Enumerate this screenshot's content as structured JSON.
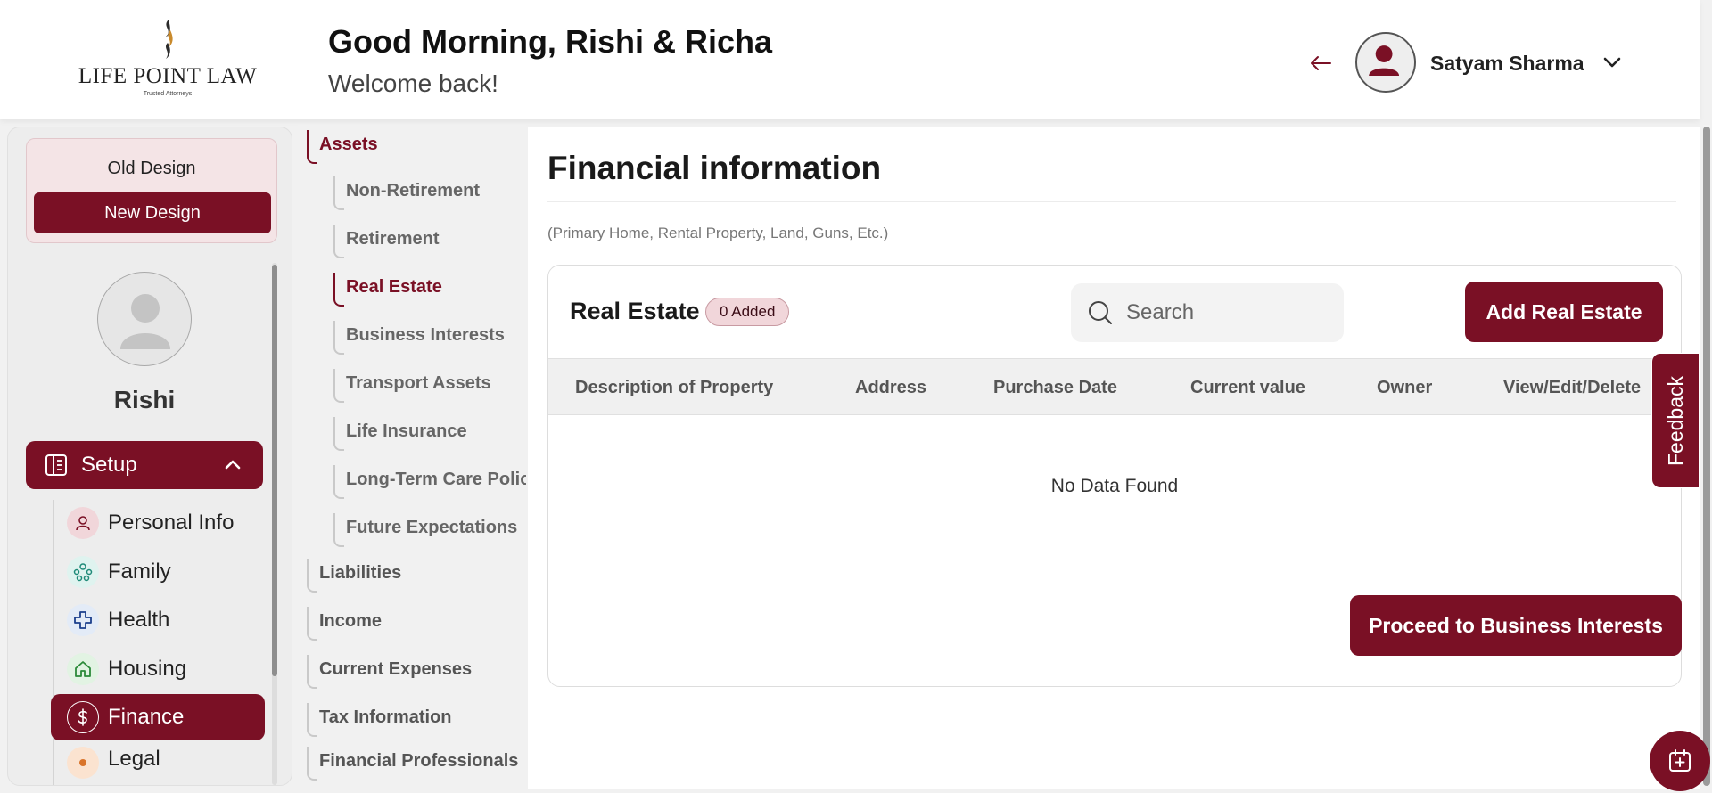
{
  "brand": {
    "name": "LIFE POINT LAW",
    "tagline": "Trusted Attorneys",
    "accent_color": "#7a1025"
  },
  "header": {
    "greeting": "Good Morning, Rishi & Richa",
    "subtitle": "Welcome back!",
    "back_icon": "arrow-left-icon",
    "user_name": "Satyam Sharma",
    "user_menu_icon": "chevron-down-icon"
  },
  "design_switch": {
    "old_label": "Old Design",
    "new_label": "New Design"
  },
  "profile": {
    "name": "Rishi"
  },
  "sidebar": {
    "setup_label": "Setup",
    "items": [
      {
        "label": "Personal Info",
        "icon": "user-icon"
      },
      {
        "label": "Family",
        "icon": "family-icon"
      },
      {
        "label": "Health",
        "icon": "medical-cross-icon"
      },
      {
        "label": "Housing",
        "icon": "home-icon"
      },
      {
        "label": "Finance",
        "icon": "dollar-icon",
        "active": true
      },
      {
        "label": "Legal",
        "icon": "legal-icon"
      }
    ]
  },
  "assets_nav": {
    "top": [
      {
        "label": "Assets",
        "active": true
      },
      {
        "label": "Liabilities"
      },
      {
        "label": "Income"
      },
      {
        "label": "Current Expenses"
      },
      {
        "label": "Tax Information"
      },
      {
        "label": "Financial Professionals"
      }
    ],
    "sub": [
      {
        "label": "Non-Retirement"
      },
      {
        "label": "Retirement"
      },
      {
        "label": "Real Estate",
        "active": true
      },
      {
        "label": "Business Interests"
      },
      {
        "label": "Transport Assets"
      },
      {
        "label": "Life Insurance"
      },
      {
        "label": "Long-Term Care Policy"
      },
      {
        "label": "Future Expectations"
      }
    ]
  },
  "main": {
    "title": "Financial information",
    "subtitle": "(Primary Home, Rental Property, Land, Guns, Etc.)",
    "card_title": "Real Estate",
    "badge": "0 Added",
    "search_placeholder": "Search",
    "add_button": "Add Real Estate",
    "columns": [
      "Description of Property",
      "Address",
      "Purchase Date",
      "Current value",
      "Owner",
      "View/Edit/Delete"
    ],
    "empty_text": "No Data Found",
    "proceed_button": "Proceed to Business Interests"
  },
  "feedback_label": "Feedback"
}
